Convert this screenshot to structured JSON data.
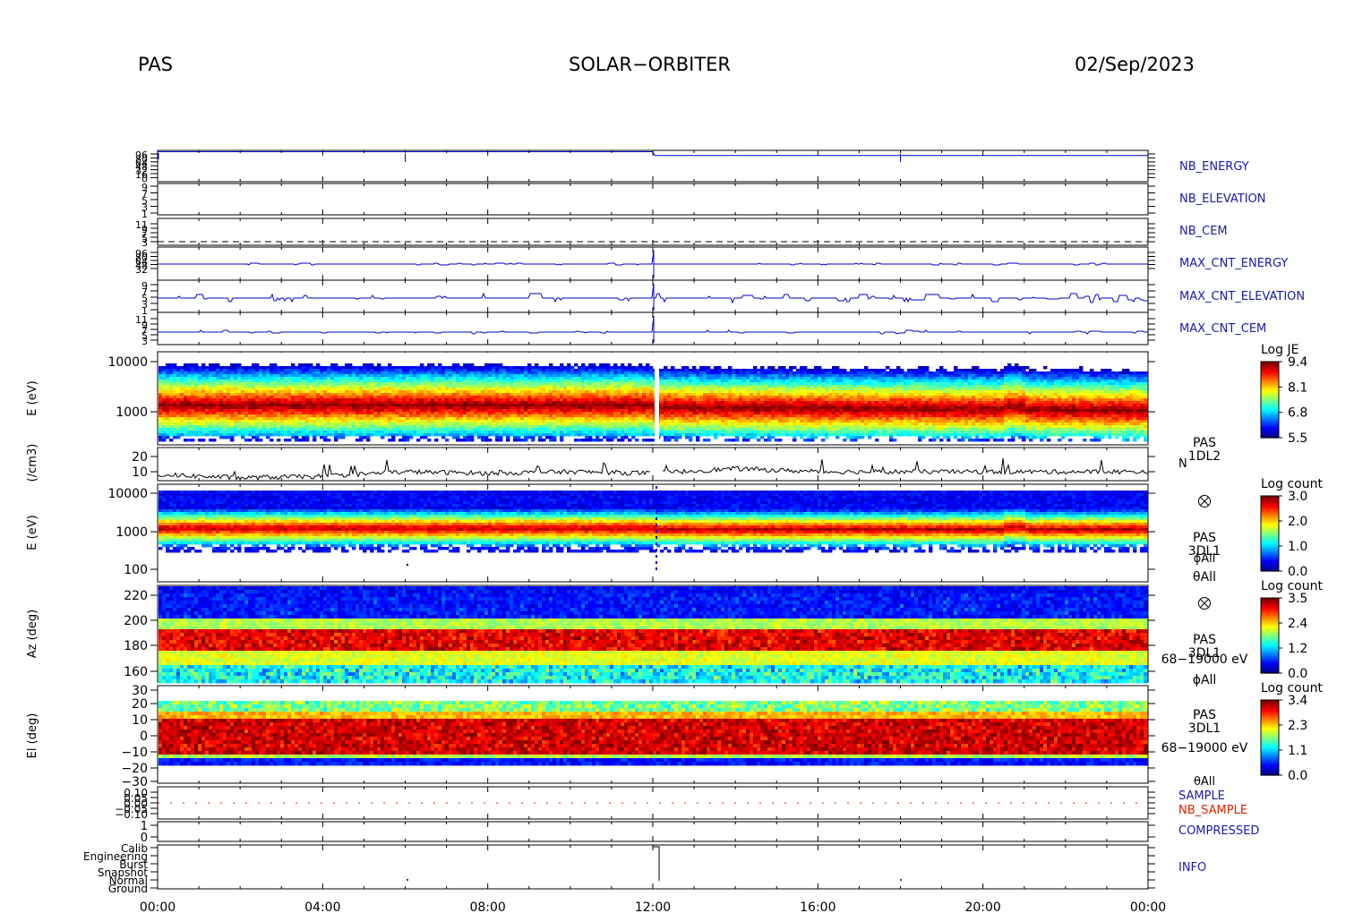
{
  "header": {
    "instrument": "PAS",
    "mission": "SOLAR−ORBITER",
    "date": "02/Sep/2023"
  },
  "time_axis": {
    "tick_labels": [
      "00:00",
      "04:00",
      "08:00",
      "12:00",
      "16:00",
      "20:00",
      "00:00"
    ]
  },
  "colors": {
    "trace_blue": "#0000cc",
    "label_blue": "#1a1aaa",
    "label_red": "#dd2200",
    "frame": "#000000"
  },
  "chart_data": [
    {
      "type": "line",
      "panel": "nb-energy",
      "series": [
        {
          "name": "NB_ENERGY",
          "color": "#0000cc"
        }
      ],
      "y_tick_labels": [
        "96",
        "80",
        "64",
        "48",
        "32",
        "16",
        "0"
      ],
      "x": [
        0,
        6,
        12,
        12.05,
        18,
        24
      ],
      "values": [
        92,
        92,
        92,
        80,
        80,
        80
      ]
    },
    {
      "type": "line",
      "panel": "nb-elevation",
      "series": [
        {
          "name": "NB_ELEVATION",
          "color": "#0000cc"
        }
      ],
      "y_tick_labels": [
        "9",
        "7",
        "5",
        "3",
        "1"
      ]
    },
    {
      "type": "line",
      "panel": "nb-cem",
      "series": [
        {
          "name": "NB_CEM",
          "color": "#000000"
        }
      ],
      "y_tick_labels": [
        "11",
        "9",
        "7",
        "5",
        "3"
      ]
    },
    {
      "type": "line",
      "panel": "max-cnt-energy",
      "series": [
        {
          "name": "MAX_CNT_ENERGY",
          "color": "#0000cc"
        }
      ],
      "y_tick_labels": [
        "96",
        "80",
        "64",
        "48",
        "32"
      ]
    },
    {
      "type": "line",
      "panel": "max-cnt-elevation",
      "series": [
        {
          "name": "MAX_CNT_ELEVATION",
          "color": "#0000cc"
        }
      ],
      "y_tick_labels": [
        "9",
        "7",
        "5",
        "3",
        "1"
      ]
    },
    {
      "type": "line",
      "panel": "max-cnt-cem",
      "series": [
        {
          "name": "MAX_CNT_CEM",
          "color": "#0000cc"
        }
      ],
      "y_tick_labels": [
        "11",
        "9",
        "7",
        "5",
        "3"
      ]
    },
    {
      "type": "heatmap",
      "panel": "pas-1dl2-spectrogram",
      "ylabel": "E (eV)",
      "y_scale": "log",
      "y_tick_labels": [
        "10000",
        "1000"
      ],
      "colorbar": {
        "title": "Log JE",
        "min": 5.5,
        "max": 9.4,
        "tick_labels": [
          "9.4",
          "8.1",
          "6.8",
          "5.5"
        ]
      },
      "peak_energy_eV": 1100,
      "labels": [
        "PAS",
        "1DL2"
      ]
    },
    {
      "type": "line",
      "panel": "density",
      "ylabel": "(/cm3)",
      "y_tick_labels": [
        "20",
        "10"
      ],
      "series": [
        {
          "name": "N",
          "color": "#000000"
        }
      ],
      "x": [
        0,
        2,
        4,
        6,
        8,
        10,
        12,
        14,
        16,
        18,
        20,
        22,
        24
      ],
      "values": [
        8,
        6,
        7,
        10,
        9,
        10,
        9,
        12,
        10,
        10,
        10,
        10,
        10
      ]
    },
    {
      "type": "heatmap",
      "panel": "pas-3dl1-energy",
      "ylabel": "E (eV)",
      "y_scale": "log",
      "y_tick_labels": [
        "10000",
        "1000",
        "100"
      ],
      "colorbar": {
        "title": "Log count",
        "min": 0.0,
        "max": 3.0,
        "tick_labels": [
          "3.0",
          "2.0",
          "1.0",
          "0.0"
        ]
      },
      "labels": [
        "PAS",
        "3DL1",
        "ϕAll",
        "θAll"
      ]
    },
    {
      "type": "heatmap",
      "panel": "pas-3dl1-azimuth",
      "ylabel": "Az (deg)",
      "y_tick_labels": [
        "220",
        "200",
        "180",
        "160"
      ],
      "colorbar": {
        "title": "Log count",
        "min": 0.0,
        "max": 3.5,
        "tick_labels": [
          "3.5",
          "2.4",
          "1.2",
          "0.0"
        ]
      },
      "labels": [
        "PAS",
        "3DL1",
        "68−19000 eV",
        "ϕAll"
      ]
    },
    {
      "type": "heatmap",
      "panel": "pas-3dl1-elevation",
      "ylabel": "El (deg)",
      "y_tick_labels": [
        "30",
        "20",
        "10",
        "0",
        "−10",
        "−20",
        "−30"
      ],
      "colorbar": {
        "title": "Log count",
        "min": 0.0,
        "max": 3.4,
        "tick_labels": [
          "3.4",
          "2.3",
          "1.1",
          "0.0"
        ]
      },
      "labels": [
        "PAS",
        "3DL1",
        "68−19000 eV",
        "θAll"
      ]
    },
    {
      "type": "line",
      "panel": "sample",
      "series": [
        {
          "name": "SAMPLE",
          "color": "#1a1aaa"
        },
        {
          "name": "NB_SAMPLE",
          "color": "#dd2200"
        }
      ],
      "y_tick_labels": [
        "0.10",
        "0.05",
        "0.00",
        "−0.05",
        "−0.10"
      ]
    },
    {
      "type": "line",
      "panel": "compressed",
      "series": [
        {
          "name": "COMPRESSED",
          "color": "#1a1aaa"
        }
      ],
      "y_tick_labels": [
        "1",
        "0"
      ]
    },
    {
      "type": "line",
      "panel": "info",
      "series": [
        {
          "name": "INFO",
          "color": "#1a1aaa"
        }
      ],
      "y_tick_labels": [
        "Calib",
        "Engineering",
        "Burst",
        "Snapshot",
        "Normal",
        "Ground"
      ]
    }
  ]
}
